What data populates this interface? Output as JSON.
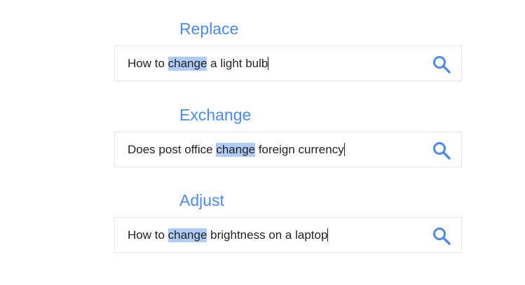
{
  "colors": {
    "accent": "#4a8af4",
    "highlight": "#aecbfa",
    "text": "#222222",
    "border": "#e6e6e6"
  },
  "examples": [
    {
      "label": "Replace",
      "query_before": "How to ",
      "query_highlight": "change",
      "query_after": " a light bulb",
      "icon": "search-icon"
    },
    {
      "label": "Exchange",
      "query_before": "Does post office ",
      "query_highlight": "change",
      "query_after": " foreign currency",
      "icon": "search-icon"
    },
    {
      "label": "Adjust",
      "query_before": "How to ",
      "query_highlight": "change",
      "query_after": " brightness on a laptop",
      "icon": "search-icon"
    }
  ]
}
